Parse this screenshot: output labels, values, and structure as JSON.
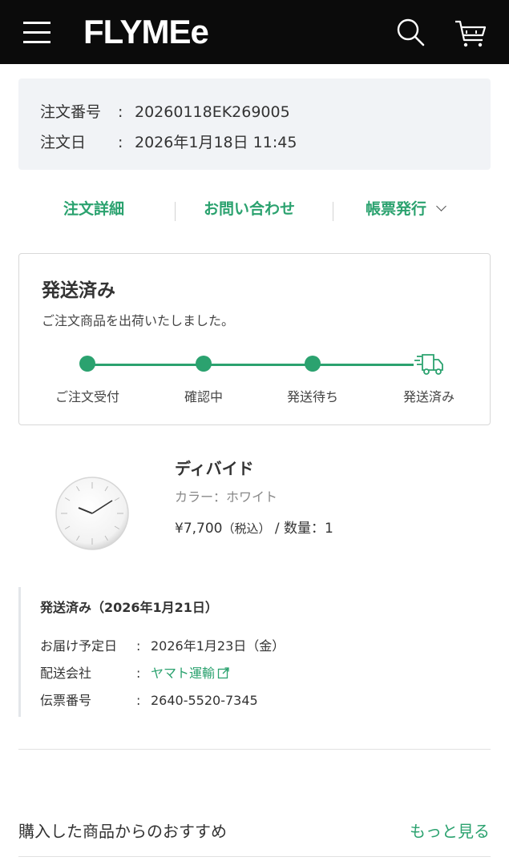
{
  "header": {
    "logo": "FLYMEe",
    "menu_icon": "hamburger-menu-icon",
    "search_icon": "search-icon",
    "cart_icon": "cart-icon",
    "background": "#0b0b0b"
  },
  "order": {
    "number_label": "注文番号",
    "number_value": "20260118EK269005",
    "date_label": "注文日",
    "date_value": "2026年1月18日 11:45",
    "separator": ":"
  },
  "actions": {
    "details": "注文詳細",
    "contact": "お問い合わせ",
    "invoice": "帳票発行"
  },
  "status": {
    "title": "発送済み",
    "message": "ご注文商品を出荷いたしました。",
    "steps": [
      "ご注文受付",
      "確認中",
      "発送待ち",
      "発送済み"
    ],
    "current_step": 4,
    "accent_color": "#2ba26f"
  },
  "product": {
    "name": "ディバイド",
    "color": "カラー：ホワイト",
    "price": "¥7,700",
    "tax": "（税込）",
    "qty": "/ 数量：1",
    "image_icon": "wall-clock-image"
  },
  "shipment": {
    "title": "発送済み（2026年1月21日）",
    "rows": [
      {
        "label": "お届け予定日",
        "value": "2026年1月23日（金）"
      },
      {
        "label": "配送会社",
        "value": "ヤマト運輸"
      },
      {
        "label": "伝票番号",
        "value": "2640-5520-7345"
      }
    ],
    "separator": ":"
  },
  "recommend": {
    "title": "購入した商品からのおすすめ",
    "more": "もっと見る"
  }
}
